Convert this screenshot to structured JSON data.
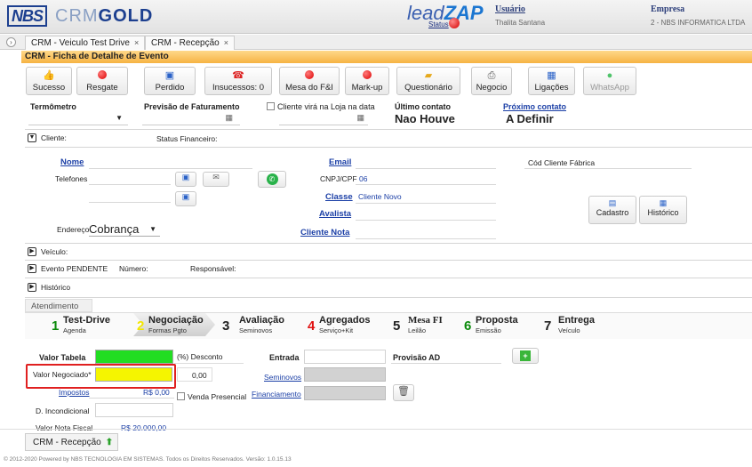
{
  "header": {
    "logo_nbs": "NBS",
    "logo_crm_prefix": "CRM",
    "logo_crm_suffix": "GOLD",
    "leadzap_prefix": "lead",
    "leadzap_suffix": "ZAP",
    "status_label": "Status",
    "usuario_label": "Usuário",
    "usuario_value": "Thalita Santana",
    "empresa_label": "Empresa",
    "empresa_value": "2 - NBS INFORMATICA LTDA"
  },
  "tabs": [
    {
      "label": "CRM - Veiculo Test Drive"
    },
    {
      "label": "CRM - Recepção"
    }
  ],
  "page_title": "CRM - Ficha de Detalhe de Evento",
  "toolbar": [
    {
      "label": "Sucesso",
      "icon": "thumbs-up-icon"
    },
    {
      "label": "Resgate",
      "icon": "download-icon"
    },
    {
      "label": "Perdido",
      "icon": "document-icon"
    },
    {
      "label": "Insucessos: 0",
      "icon": "phone-icon"
    },
    {
      "label": "Mesa do F&I",
      "icon": "red-dot-icon"
    },
    {
      "label": "Mark-up",
      "icon": "red-dot-icon"
    },
    {
      "label": "Questionário",
      "icon": "folder-icon"
    },
    {
      "label": "Negocio",
      "icon": "printer-icon"
    },
    {
      "label": "Ligações",
      "icon": "contacts-icon"
    },
    {
      "label": "WhatsApp",
      "icon": "whatsapp-icon"
    }
  ],
  "summary": {
    "termometro_label": "Termômetro",
    "previsao_label": "Previsão de Faturamento",
    "cliente_loja_label": "Cliente virá na Loja na data",
    "ultimo_contato_label": "Último contato",
    "ultimo_contato_value": "Nao Houve",
    "proximo_contato_label": "Próximo contato",
    "proximo_contato_value": "A Definir"
  },
  "cliente_section": {
    "title": "Cliente:",
    "status_financeiro": "Status Financeiro:",
    "nome": "Nome",
    "telefones": "Telefones",
    "email": "Email",
    "cnpj_label": "CNPJ/CPF",
    "cnpj_value": "06",
    "classe": "Classe",
    "classe_value": "Cliente Novo",
    "avalista": "Avalista",
    "cliente_nota": "Cliente Nota",
    "cod_cliente_fabrica": "Cód Cliente Fábrica",
    "endereco_label": "Endereço",
    "endereco_value": "Cobrança",
    "cadastro": "Cadastro",
    "historico": "Histórico"
  },
  "sections": {
    "veiculo": "Veículo:",
    "evento": "Evento PENDENTE",
    "numero": "Número:",
    "responsavel": "Responsável:",
    "historico": "Histórico"
  },
  "atendimento": "Atendimento",
  "steps": [
    {
      "n": "1",
      "title": "Test-Drive",
      "sub": "Agenda"
    },
    {
      "n": "2",
      "title": "Negociação",
      "sub": "Formas Pgto"
    },
    {
      "n": "3",
      "title": "Avaliação",
      "sub": "Seminovos"
    },
    {
      "n": "4",
      "title": "Agregados",
      "sub": "Serviço+Kit"
    },
    {
      "n": "5",
      "title": "Mesa FI",
      "sub": "Leilão"
    },
    {
      "n": "6",
      "title": "Proposta",
      "sub": "Emissão"
    },
    {
      "n": "7",
      "title": "Entrega",
      "sub": "Veículo"
    }
  ],
  "negociacao": {
    "valor_tabela": "Valor Tabela",
    "desconto": "(%) Desconto",
    "valor_negociado": "Valor Negociado*",
    "valor_negociado_value": "0,00",
    "impostos": "Impostos",
    "impostos_value": "R$ 0,00",
    "venda_presencial": "Venda Presencial",
    "d_incondicional": "D. Incondicional",
    "valor_nota_fiscal": "Valor Nota Fiscal",
    "valor_nota_fiscal_value": "R$ 20.000,00",
    "entrada": "Entrada",
    "seminovos": "Seminovos",
    "financiamento": "Financiamento",
    "provisao_ad": "Provisão AD"
  },
  "footer": {
    "tab_label": "CRM - Recepção",
    "copyright": "© 2012-2020 Powered by NBS TECNOLOGIA EM SISTEMAS. Todos os Direitos Reservados.   Versão: 1.0.15.13"
  },
  "colors": {
    "title_bar": "#f6b343",
    "green_field": "#22dd22",
    "yellow_field": "#f5f500",
    "highlight_border": "#e02020",
    "link": "#1b3fa6"
  }
}
